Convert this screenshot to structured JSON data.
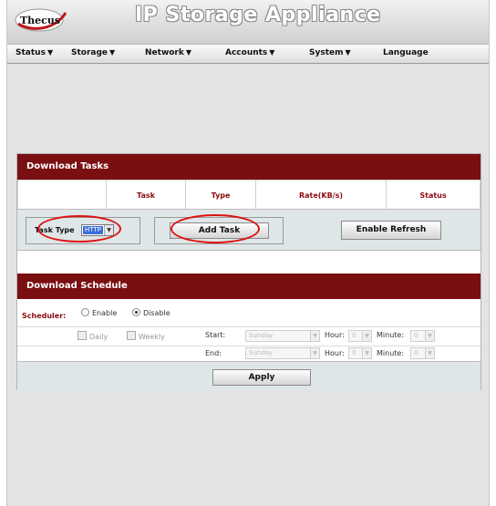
{
  "header": {
    "logo_text": "Thecus",
    "title": "IP Storage Appliance"
  },
  "menu": [
    {
      "label": "Status",
      "has_arrow": true
    },
    {
      "label": "Storage",
      "has_arrow": true
    },
    {
      "label": "Network",
      "has_arrow": true
    },
    {
      "label": "Accounts",
      "has_arrow": true
    },
    {
      "label": "System",
      "has_arrow": true
    },
    {
      "label": "Language",
      "has_arrow": false
    }
  ],
  "menu_arrow": "▼",
  "download_tasks": {
    "title": "Download Tasks",
    "columns": [
      "Task",
      "Type",
      "Rate(KB/s)",
      "Status"
    ]
  },
  "toolbar": {
    "task_type_label": "Task Type",
    "task_type_value": "HTTP",
    "add_task_label": "Add Task",
    "enable_refresh_label": "Enable Refresh"
  },
  "schedule": {
    "title": "Download Schedule",
    "scheduler_label": "Scheduler:",
    "enable_label": "Enable",
    "disable_label": "Disable",
    "selected": "Disable",
    "daily_label": "Daily",
    "weekly_label": "Weekly",
    "start_label": "Start:",
    "end_label": "End:",
    "start_day": "Sunday",
    "end_day": "Sunday",
    "hour_label": "Hour:",
    "minute_label": "Minute:",
    "start_hour": "0",
    "start_minute": "0",
    "end_hour": "0",
    "end_minute": "0"
  },
  "apply_label": "Apply",
  "colors": {
    "header_bar": "#7a0f12",
    "accent_text": "#8b0b10",
    "annotation": "#dd1111",
    "panel_bg": "#dfe6e8"
  }
}
